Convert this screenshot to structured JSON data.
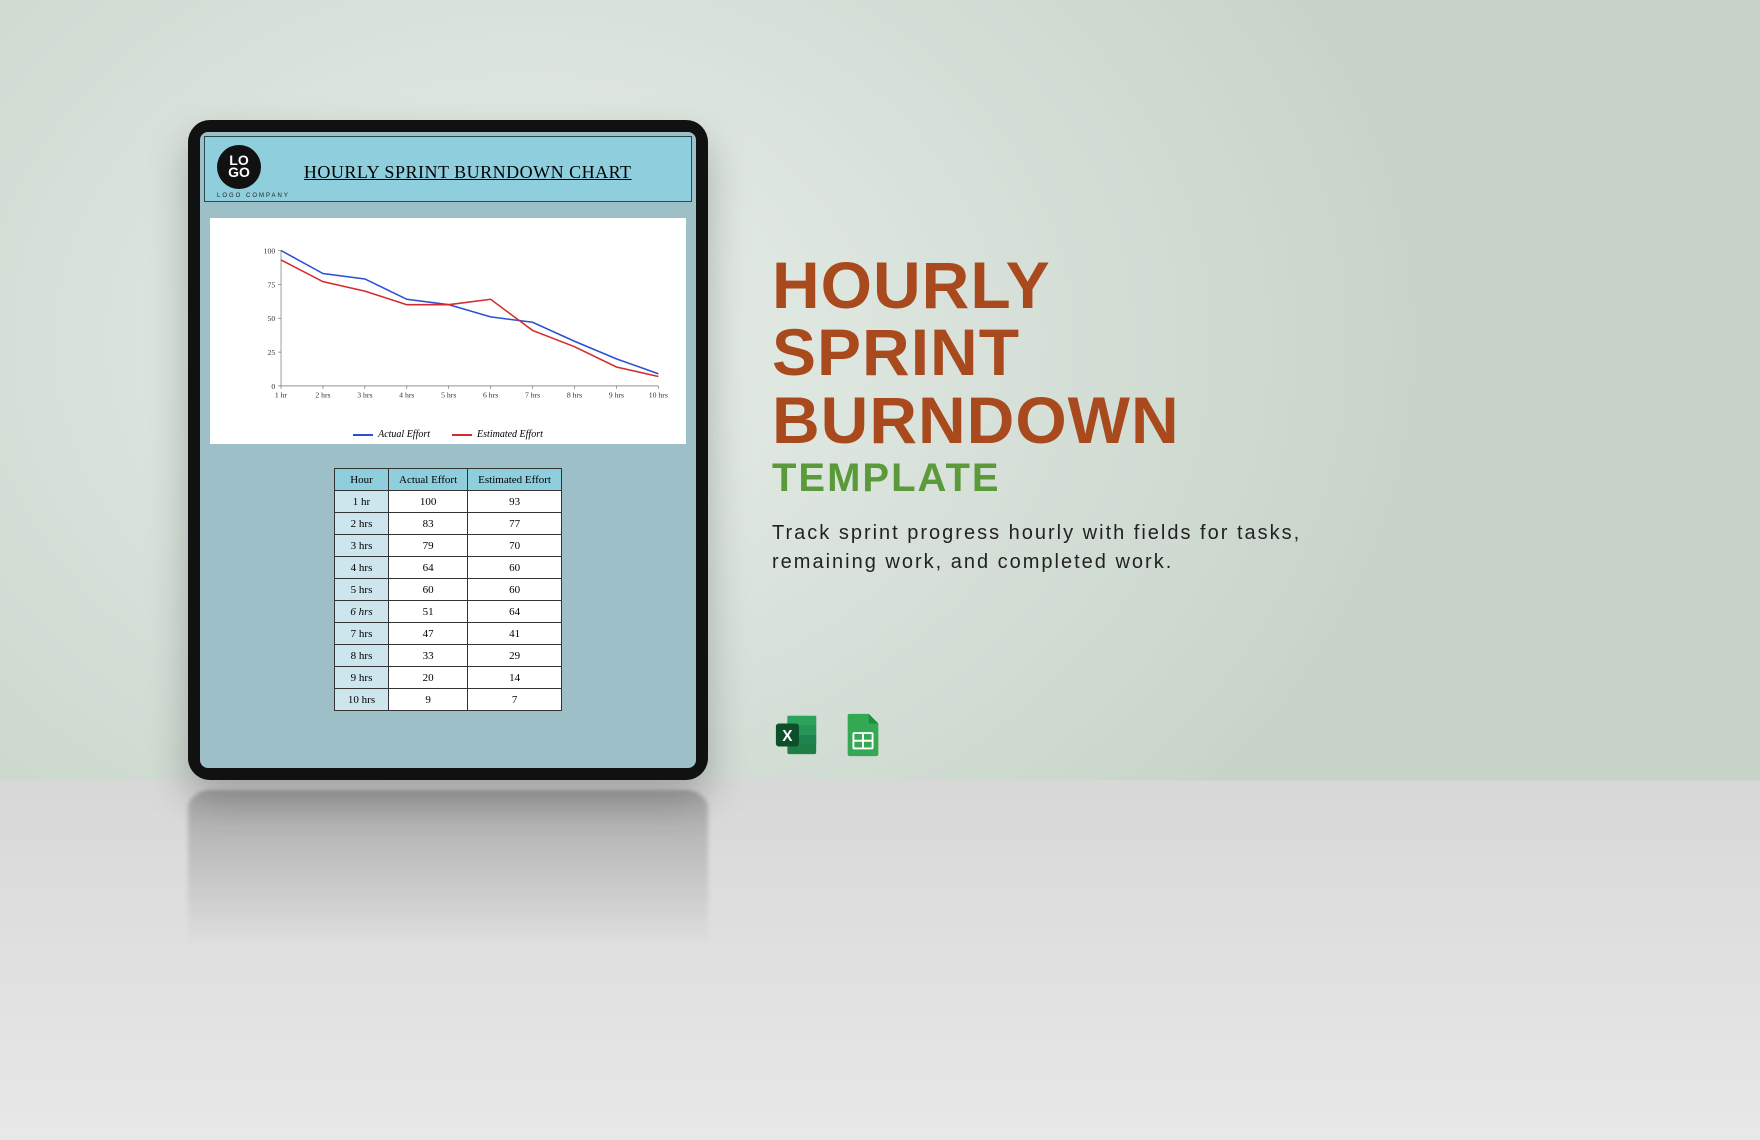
{
  "document": {
    "logo_line1": "LO",
    "logo_line2": "GO",
    "logo_sub": "LOGO COMPANY",
    "title": "HOURLY SPRINT BURNDOWN CHART"
  },
  "legend": {
    "series_a": "Actual Effort",
    "series_b": "Estimated Effort"
  },
  "table": {
    "headers": {
      "hour": "Hour",
      "actual": "Actual Effort",
      "estimated": "Estimated Effort"
    },
    "rows": [
      {
        "hour": "1 hr",
        "actual": 100,
        "estimated": 93
      },
      {
        "hour": "2 hrs",
        "actual": 83,
        "estimated": 77
      },
      {
        "hour": "3 hrs",
        "actual": 79,
        "estimated": 70
      },
      {
        "hour": "4 hrs",
        "actual": 64,
        "estimated": 60
      },
      {
        "hour": "5 hrs",
        "actual": 60,
        "estimated": 60
      },
      {
        "hour": "6 hrs",
        "actual": 51,
        "estimated": 64
      },
      {
        "hour": "7 hrs",
        "actual": 47,
        "estimated": 41
      },
      {
        "hour": "8 hrs",
        "actual": 33,
        "estimated": 29
      },
      {
        "hour": "9 hrs",
        "actual": 20,
        "estimated": 14
      },
      {
        "hour": "10 hrs",
        "actual": 9,
        "estimated": 7
      }
    ]
  },
  "chart_data": {
    "type": "line",
    "title": "Hourly Sprint Burndown Chart",
    "xlabel": "",
    "ylabel": "",
    "categories": [
      "1 hr",
      "2 hrs",
      "3 hrs",
      "4 hrs",
      "5 hrs",
      "6 hrs",
      "7 hrs",
      "8 hrs",
      "9 hrs",
      "10 hrs"
    ],
    "y_ticks": [
      0,
      25,
      50,
      75,
      100
    ],
    "ylim": [
      0,
      100
    ],
    "series": [
      {
        "name": "Actual Effort",
        "color": "#2b4fd6",
        "values": [
          100,
          83,
          79,
          64,
          60,
          51,
          47,
          33,
          20,
          9
        ]
      },
      {
        "name": "Estimated Effort",
        "color": "#d22c2c",
        "values": [
          93,
          77,
          70,
          60,
          60,
          64,
          41,
          29,
          14,
          7
        ]
      }
    ]
  },
  "promo": {
    "headline": "HOURLY\nSPRINT\nBURNDOWN",
    "subhead": "TEMPLATE",
    "body": "Track sprint progress hourly with fields for tasks, remaining work, and completed work."
  },
  "apps": {
    "excel": "Excel",
    "sheets": "Google Sheets"
  }
}
